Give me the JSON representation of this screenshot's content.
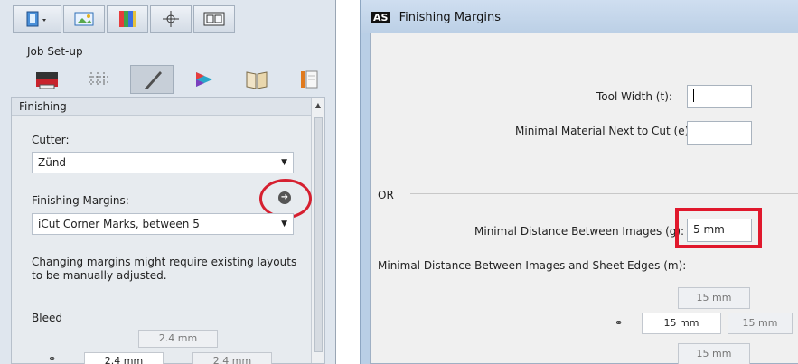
{
  "left_panel": {
    "job_title": "Job Set-up",
    "section_title": "Finishing",
    "cutter_label": "Cutter:",
    "cutter_value": "Zünd",
    "margins_label": "Finishing Margins:",
    "margins_value": "iCut Corner Marks, between 5",
    "warning_line1": "Changing margins might require existing layouts",
    "warning_line2": "to be manually adjusted.",
    "bleed_label": "Bleed",
    "bleed_top": "2.4 mm",
    "bleed_left": "2.4 mm",
    "bleed_right": "2.4 mm"
  },
  "dialog": {
    "title": "Finishing Margins",
    "app_icon": "AS",
    "tool_width_label": "Tool Width (t):",
    "tool_width_value": "",
    "min_material_label": "Minimal Material Next to Cut (e):",
    "min_material_value": "",
    "or_label": "OR",
    "min_distance_label": "Minimal Distance Between Images (g):",
    "min_distance_value": "5 mm",
    "sheet_edges_label": "Minimal Distance Between Images and Sheet Edges (m):",
    "edge_top": "15 mm",
    "edge_left": "15 mm",
    "edge_right": "15 mm",
    "edge_bottom": "15 mm"
  },
  "colors": {
    "highlight": "#e0182c"
  },
  "icons": [
    "page-icon",
    "image-icon",
    "palette-icon",
    "crosshair-icon",
    "layout-icon",
    "printer-icon",
    "grid-icon",
    "pen-icon",
    "color-wheel-icon",
    "book-icon",
    "pages-icon",
    "link-icon",
    "arrow-right-circle-icon"
  ]
}
